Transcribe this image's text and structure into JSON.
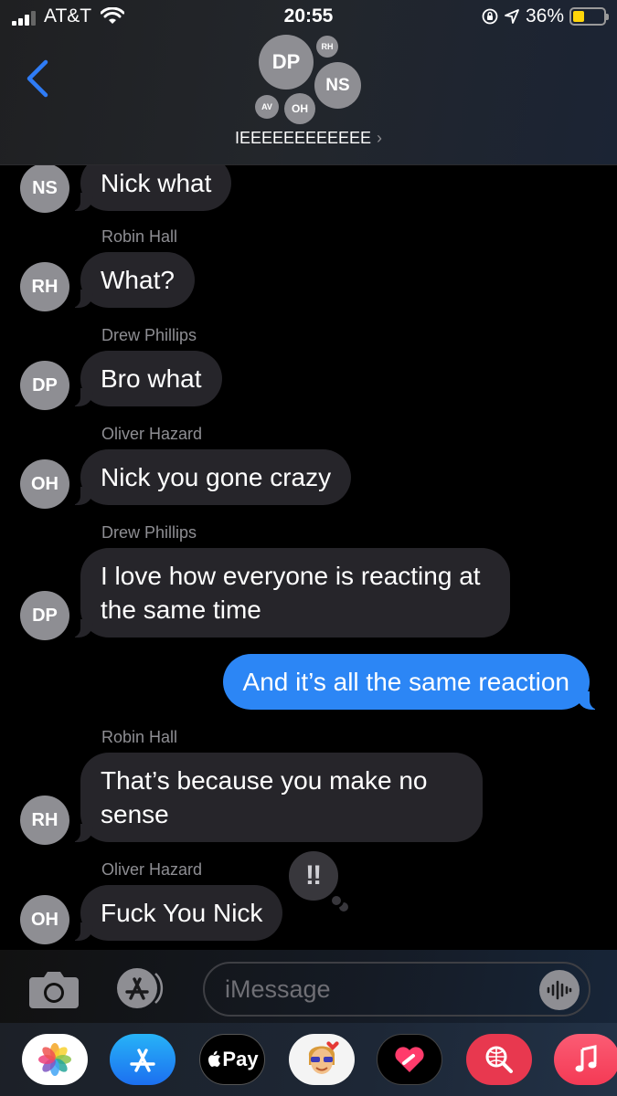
{
  "status_bar": {
    "carrier": "AT&T",
    "time": "20:55",
    "battery": "36%",
    "battery_level": 0.36
  },
  "header": {
    "group_name": "IEEEEEEEEEEEE",
    "avatars": [
      "DP",
      "NS",
      "RH",
      "AV",
      "OH"
    ]
  },
  "messages": [
    {
      "sender": "",
      "initials": "NS",
      "text": "Nick what"
    },
    {
      "sender": "Robin Hall",
      "initials": "RH",
      "text": "What?"
    },
    {
      "sender": "Drew Phillips",
      "initials": "DP",
      "text": "Bro what"
    },
    {
      "sender": "Oliver Hazard",
      "initials": "OH",
      "text": "Nick you gone crazy"
    },
    {
      "sender": "Drew Phillips",
      "initials": "DP",
      "text": "I love how everyone is reacting at the same time"
    },
    {
      "sender": "me",
      "initials": "",
      "text": "And it’s all the same reaction"
    },
    {
      "sender": "Robin Hall",
      "initials": "RH",
      "text": "That’s because you make no sense"
    },
    {
      "sender": "Oliver Hazard",
      "initials": "OH",
      "text": "Fuck You Nick",
      "tapback": "‼"
    }
  ],
  "input": {
    "placeholder": "iMessage"
  },
  "drawer": {
    "apple_pay_label": "Pay",
    "apps": [
      "photos",
      "app-store",
      "apple-pay",
      "memoji",
      "digital-touch",
      "web-images",
      "music"
    ]
  },
  "colors": {
    "outgoing_bubble": "#2c86f5",
    "incoming_bubble": "#26252a",
    "accent": "#2f7cf6",
    "battery": "#ffd60a"
  }
}
